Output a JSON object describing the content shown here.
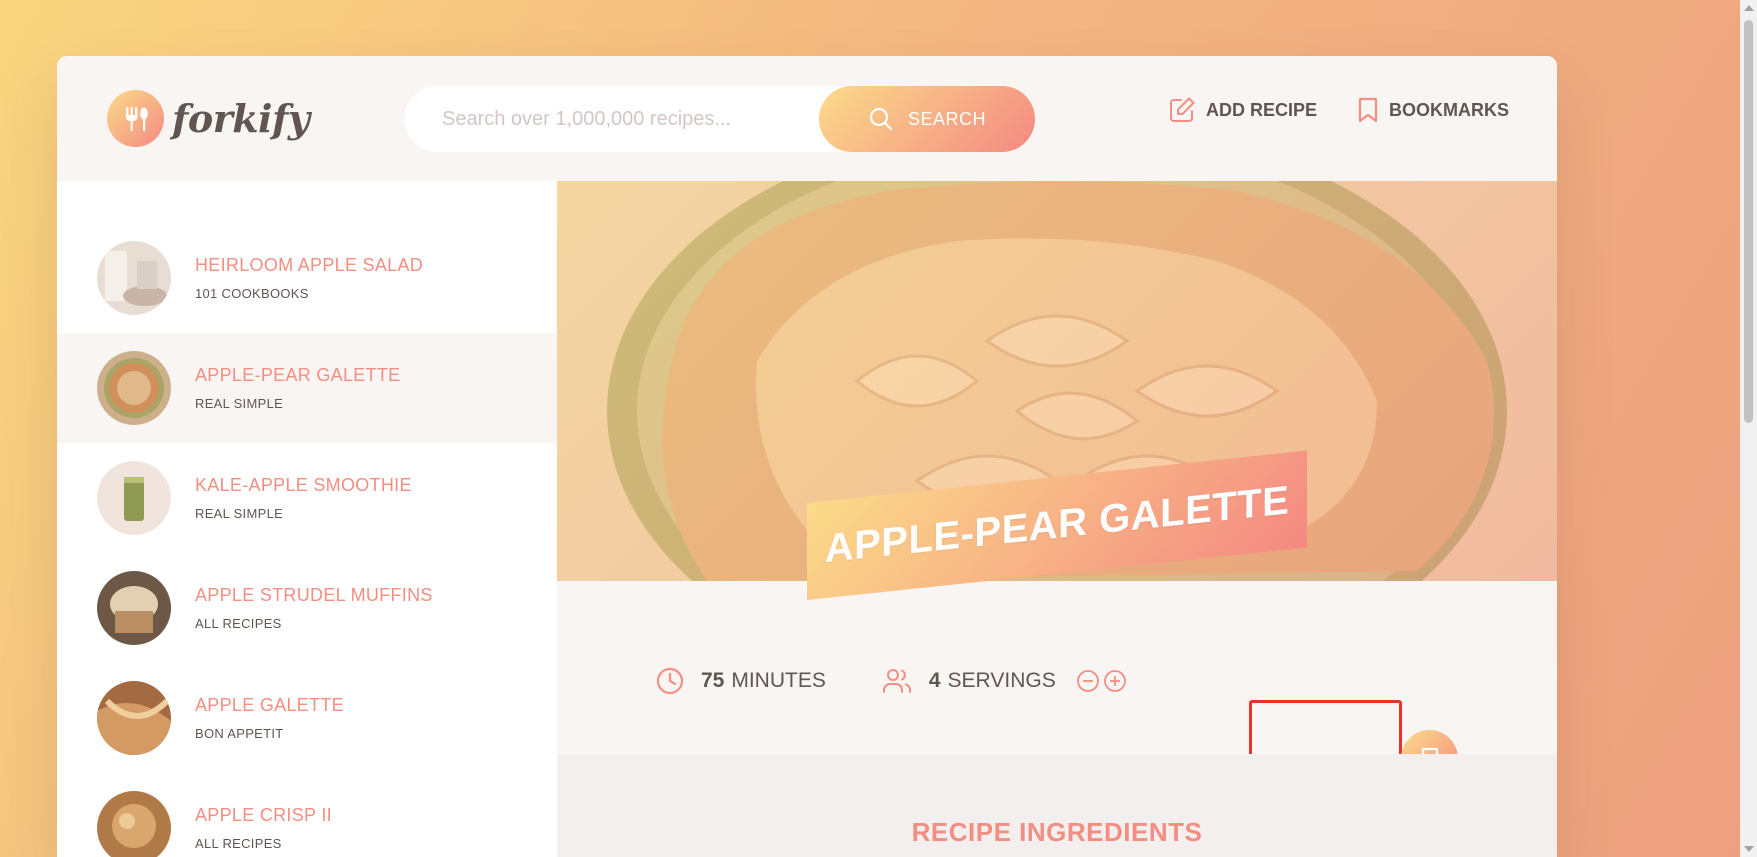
{
  "header": {
    "logo_text": "forkify",
    "search_placeholder": "Search over 1,000,000 recipes...",
    "search_button": "SEARCH",
    "nav": {
      "add_recipe": "ADD RECIPE",
      "bookmarks": "BOOKMARKS"
    }
  },
  "results": [
    {
      "title": "HEIRLOOM APPLE SALAD",
      "publisher": "101 COOKBOOKS",
      "active": false
    },
    {
      "title": "APPLE-PEAR GALETTE",
      "publisher": "REAL SIMPLE",
      "active": true
    },
    {
      "title": "KALE-APPLE SMOOTHIE",
      "publisher": "REAL SIMPLE",
      "active": false
    },
    {
      "title": "APPLE STRUDEL MUFFINS",
      "publisher": "ALL RECIPES",
      "active": false
    },
    {
      "title": "APPLE GALETTE",
      "publisher": "BON APPETIT",
      "active": false
    },
    {
      "title": "APPLE CRISP II",
      "publisher": "ALL RECIPES",
      "active": false
    }
  ],
  "recipe": {
    "title": "APPLE-PEAR GALETTE",
    "cooking_time": "75",
    "cooking_time_unit": "MINUTES",
    "servings": "4",
    "servings_unit": "SERVINGS",
    "ingredients_heading": "RECIPE INGREDIENTS"
  },
  "colors": {
    "accent": "#f38e82",
    "gradient_start": "#fbdb89",
    "gradient_end": "#f48982",
    "text": "#615551",
    "focus": "#e5322b"
  }
}
